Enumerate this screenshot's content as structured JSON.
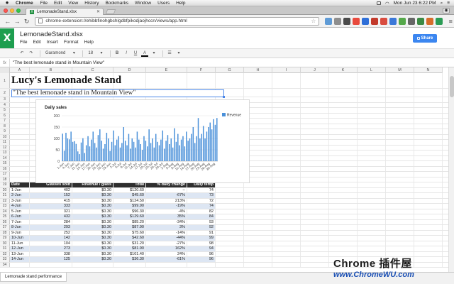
{
  "macbar": {
    "app": "Chrome",
    "menus": [
      "File",
      "Edit",
      "View",
      "History",
      "Bookmarks",
      "Window",
      "Users",
      "Help"
    ],
    "clock": "Mon Jun 23  6:22 PM"
  },
  "tab": {
    "title": "LemonadeStand.xlsx"
  },
  "omnibox": {
    "url": "chrome-extension://ehibbfinohgbchlgdbfpikodjaojhccn/views/app.html"
  },
  "app": {
    "logo": "X",
    "title": "LemonadeStand.xlsx",
    "menus": [
      "File",
      "Edit",
      "Insert",
      "Format",
      "Help"
    ],
    "share": "Share"
  },
  "format_toolbar": {
    "font": "Garamond",
    "size": "18",
    "bold": "B",
    "italic": "I",
    "underline": "U",
    "textcolor": "A"
  },
  "formula_bar": {
    "fx": "fx",
    "value": "\"The best lemonade stand in Mountain View\""
  },
  "columns": [
    "A",
    "B",
    "C",
    "D",
    "E",
    "F",
    "G",
    "H",
    "I",
    "J",
    "K",
    "L",
    "M",
    "N"
  ],
  "rows_visible": [
    1,
    2,
    3,
    4,
    5,
    6,
    7,
    8,
    9,
    10,
    11,
    12,
    13,
    14,
    15,
    16,
    17,
    18,
    19,
    20,
    21,
    22,
    23,
    24,
    25,
    26,
    27,
    28,
    29,
    30,
    31,
    32,
    33,
    34
  ],
  "sheet": {
    "title": "Lucy's Lemonade Stand",
    "subtitle": "\"The best lemonade stand in Mountain View\"",
    "table_headers": [
      "Date",
      "Glasses sold",
      "Revenue / glass",
      "Total",
      "% daily change",
      "Daily temp"
    ],
    "table_rows": [
      [
        "1-Jun",
        "402",
        "$0.30",
        "$120.60",
        "--",
        "74"
      ],
      [
        "2-Jun",
        "152",
        "$0.30",
        "$45.60",
        "-67%",
        "73"
      ],
      [
        "3-Jun",
        "415",
        "$0.30",
        "$124.50",
        "213%",
        "72"
      ],
      [
        "4-Jun",
        "333",
        "$0.30",
        "$99.90",
        "-19%",
        "74"
      ],
      [
        "5-Jun",
        "321",
        "$0.30",
        "$96.30",
        "-4%",
        "82"
      ],
      [
        "6-Jun",
        "432",
        "$0.30",
        "$129.60",
        "35%",
        "84"
      ],
      [
        "7-Jun",
        "284",
        "$0.30",
        "$85.20",
        "-34%",
        "93"
      ],
      [
        "8-Jun",
        "293",
        "$0.30",
        "$87.90",
        "3%",
        "92"
      ],
      [
        "9-Jun",
        "252",
        "$0.30",
        "$75.60",
        "-14%",
        "91"
      ],
      [
        "10-Jun",
        "142",
        "$0.30",
        "$42.60",
        "-44%",
        "99"
      ],
      [
        "11-Jun",
        "104",
        "$0.30",
        "$31.20",
        "-27%",
        "98"
      ],
      [
        "12-Jun",
        "273",
        "$0.30",
        "$81.90",
        "162%",
        "94"
      ],
      [
        "13-Jun",
        "338",
        "$0.30",
        "$101.40",
        "24%",
        "96"
      ],
      [
        "14-Jun",
        "125",
        "$0.30",
        "$36.30",
        "-61%",
        "96"
      ]
    ]
  },
  "chart_data": {
    "type": "bar",
    "title": "Daily sales",
    "legend": "Revenue",
    "legend_position": "right",
    "ylim": [
      0,
      200
    ],
    "yticks": [
      0,
      50,
      100,
      150,
      200
    ],
    "xtick_labels": [
      "1-Jun",
      "4-Jun",
      "7-Jun",
      "11-Jun",
      "14-Jun",
      "17-Jun",
      "20-Jun",
      "23-Jun",
      "26-Jun",
      "29-Jun",
      "2-Jul",
      "5-Jul",
      "8-Jul",
      "11-Jul",
      "14-Jul",
      "17-Jul",
      "20-Jul",
      "23-Jul",
      "26-Jul",
      "29-Jul",
      "2-Aug",
      "5-Aug",
      "8-Aug",
      "11-Aug",
      "14-Aug",
      "17-Aug",
      "20-Aug",
      "23-Aug",
      "26-Aug",
      "30-Aug"
    ],
    "series": [
      {
        "name": "Revenue",
        "values": [
          121,
          46,
          125,
          100,
          96,
          130,
          85,
          88,
          76,
          43,
          31,
          82,
          101,
          36,
          70,
          110,
          65,
          95,
          130,
          80,
          60,
          115,
          140,
          90,
          55,
          75,
          125,
          100,
          45,
          85,
          135,
          70,
          95,
          110,
          60,
          80,
          150,
          90,
          70,
          120,
          55,
          100,
          85,
          60,
          130,
          95,
          75,
          50,
          110,
          90,
          65,
          140,
          80,
          100,
          60,
          120,
          85,
          70,
          95,
          135,
          55,
          90,
          115,
          75,
          100,
          60,
          145,
          85,
          120,
          70,
          95,
          110,
          65,
          130,
          90,
          100,
          120,
          150,
          80,
          110,
          190,
          100,
          120,
          155,
          100,
          130,
          150,
          170,
          140,
          185,
          160,
          190
        ]
      }
    ]
  },
  "sheet_tab": "Lemonade stand performance",
  "watermark": {
    "line1": "Chrome 插件屋",
    "line2": "www.ChromeWU.com"
  }
}
